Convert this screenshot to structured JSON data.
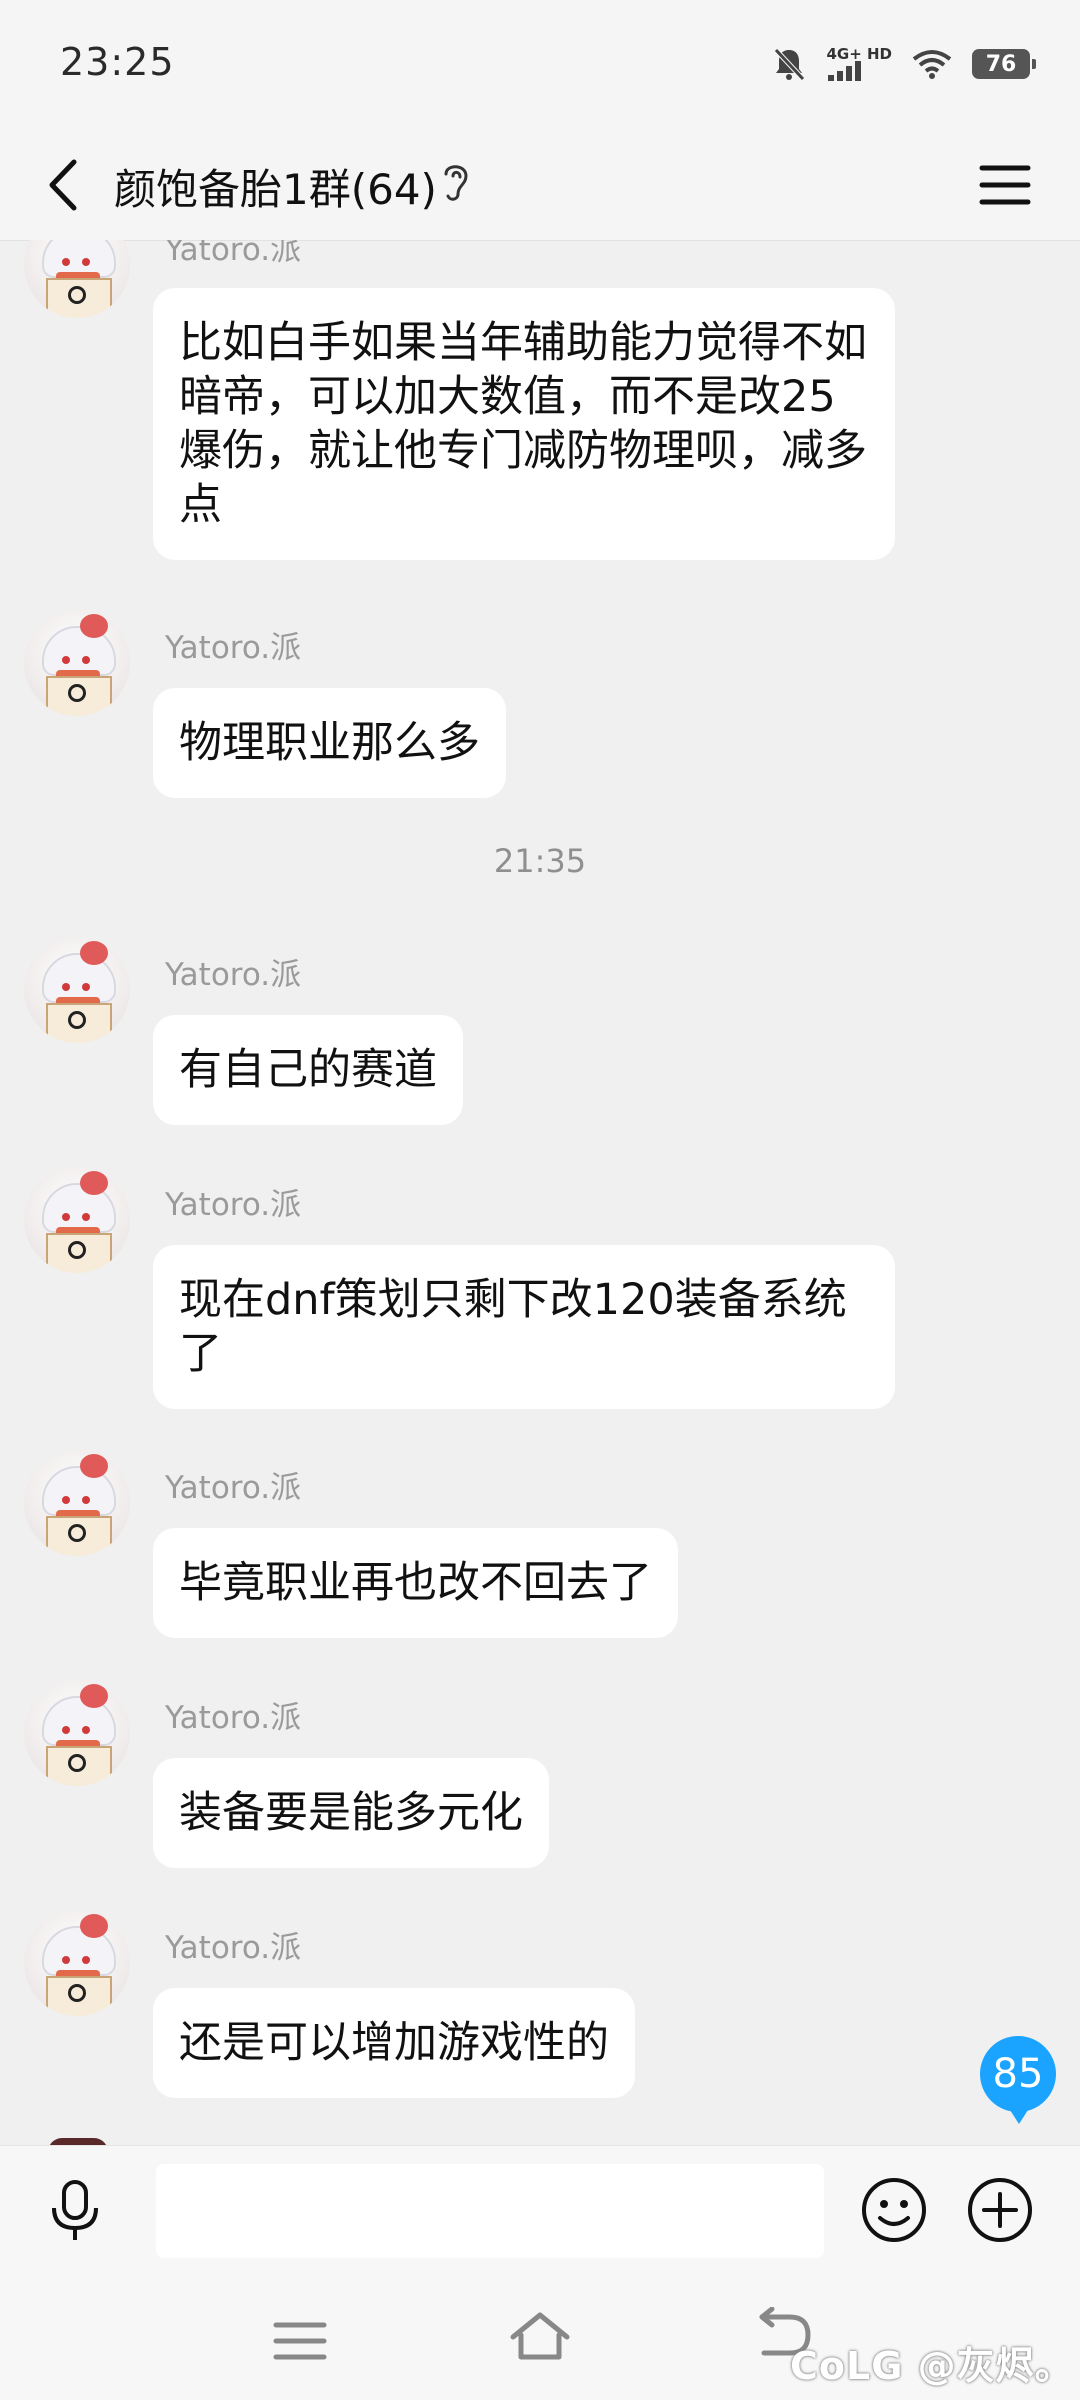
{
  "status_bar": {
    "time": "23:25",
    "network": "4G+ HD",
    "battery": "76"
  },
  "header": {
    "title": "颜饱备胎1群(64)"
  },
  "messages": [
    {
      "sender": "Yatoro.派",
      "text": "比如白手如果当年辅助能力觉得不如暗帝，可以加大数值，而不是改25爆伤，就让他专门减防物理呗，减多点"
    },
    {
      "sender": "Yatoro.派",
      "text": "物理职业那么多"
    },
    {
      "sender": "Yatoro.派",
      "text": "有自己的赛道"
    },
    {
      "sender": "Yatoro.派",
      "text": "现在dnf策划只剩下改120装备系统了"
    },
    {
      "sender": "Yatoro.派",
      "text": "毕竟职业再也改不回去了"
    },
    {
      "sender": "Yatoro.派",
      "text": "装备要是能多元化"
    },
    {
      "sender": "Yatoro.派",
      "text": "还是可以增加游戏性的"
    }
  ],
  "timestamp": "21:35",
  "unread_count": "85",
  "input": {
    "value": "",
    "placeholder": ""
  },
  "watermark": "CoLG @灰烬。",
  "colors": {
    "badge": "#1aa3ff",
    "background": "#f0f0f0",
    "bubble": "#ffffff"
  }
}
